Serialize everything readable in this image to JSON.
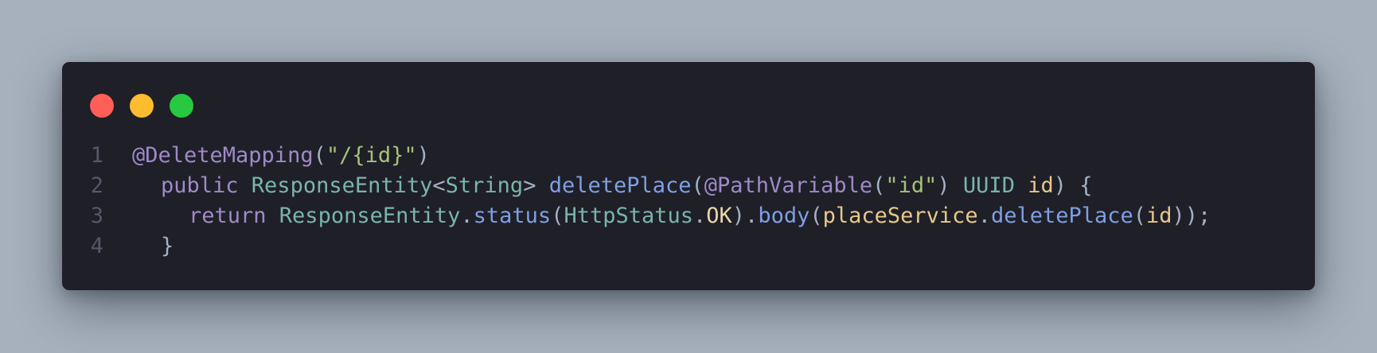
{
  "window": {
    "controls": [
      {
        "name": "close",
        "color": "#ff5f57"
      },
      {
        "name": "minimize",
        "color": "#febc2e"
      },
      {
        "name": "maximize",
        "color": "#28c840"
      }
    ]
  },
  "code": {
    "language": "java",
    "lines": [
      {
        "number": "1",
        "indent": 0,
        "tokens": [
          {
            "text": "@DeleteMapping",
            "kind": "anno"
          },
          {
            "text": "(",
            "kind": "punc"
          },
          {
            "text": "\"/{id}\"",
            "kind": "str"
          },
          {
            "text": ")",
            "kind": "punc"
          }
        ]
      },
      {
        "number": "2",
        "indent": 1,
        "tokens": [
          {
            "text": "public ",
            "kind": "kw"
          },
          {
            "text": "ResponseEntity",
            "kind": "type"
          },
          {
            "text": "<",
            "kind": "punc"
          },
          {
            "text": "String",
            "kind": "type"
          },
          {
            "text": "> ",
            "kind": "punc"
          },
          {
            "text": "deletePlace",
            "kind": "fn"
          },
          {
            "text": "(",
            "kind": "punc"
          },
          {
            "text": "@PathVariable",
            "kind": "anno"
          },
          {
            "text": "(",
            "kind": "punc"
          },
          {
            "text": "\"id\"",
            "kind": "str"
          },
          {
            "text": ") ",
            "kind": "punc"
          },
          {
            "text": "UUID ",
            "kind": "type"
          },
          {
            "text": "id",
            "kind": "param"
          },
          {
            "text": ") {",
            "kind": "punc"
          }
        ]
      },
      {
        "number": "3",
        "indent": 2,
        "tokens": [
          {
            "text": "return ",
            "kind": "kw"
          },
          {
            "text": "ResponseEntity",
            "kind": "type"
          },
          {
            "text": ".",
            "kind": "punc"
          },
          {
            "text": "status",
            "kind": "fn"
          },
          {
            "text": "(",
            "kind": "punc"
          },
          {
            "text": "HttpStatus",
            "kind": "type"
          },
          {
            "text": ".",
            "kind": "punc"
          },
          {
            "text": "OK",
            "kind": "const"
          },
          {
            "text": ").",
            "kind": "punc"
          },
          {
            "text": "body",
            "kind": "fn"
          },
          {
            "text": "(",
            "kind": "punc"
          },
          {
            "text": "placeService",
            "kind": "var"
          },
          {
            "text": ".",
            "kind": "punc"
          },
          {
            "text": "deletePlace",
            "kind": "fn"
          },
          {
            "text": "(",
            "kind": "punc"
          },
          {
            "text": "id",
            "kind": "param"
          },
          {
            "text": "));",
            "kind": "punc"
          }
        ]
      },
      {
        "number": "4",
        "indent": 1,
        "tokens": [
          {
            "text": "}",
            "kind": "punc"
          }
        ]
      }
    ]
  }
}
